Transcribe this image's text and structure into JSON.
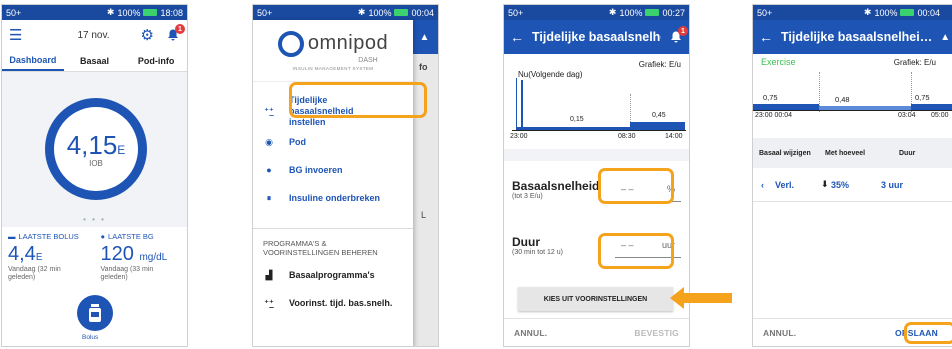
{
  "colors": {
    "brand": "#1e55b5",
    "highlight": "#f5a21c",
    "battery": "#3bd16f",
    "badge": "#e23b3b"
  },
  "status": {
    "signal": "50+",
    "battery": "100%",
    "time1": "18:08",
    "time2": "00:04",
    "time3": "00:27",
    "time4": "00:04"
  },
  "screen1": {
    "date": "17 nov.",
    "badge_count": "1",
    "tabs": [
      "Dashboard",
      "Basaal",
      "Pod-info"
    ],
    "iob_value": "4,15",
    "iob_unit": "E",
    "iob_label": "IOB",
    "dots": "• • •",
    "last_bolus_label": "LAATSTE BOLUS",
    "last_bolus_value": "4,4",
    "last_bolus_unit": "E",
    "last_bolus_sub": "Vandaag (32 min geleden)",
    "last_bg_label": "LAATSTE BG",
    "last_bg_value": "120",
    "last_bg_unit": "mg/dL",
    "last_bg_sub": "Vandaag (33 min geleden)",
    "bolus_label": "Bolus"
  },
  "screen2": {
    "logo_word": "omnipod",
    "logo_dash": "DASH",
    "logo_tagline": "INSULIN MANAGEMENT SYSTEM",
    "behind_text": "fo",
    "behind_text2": "L",
    "menu": [
      "Tijdelijke basaalsnelheid instellen",
      "Pod",
      "BG invoeren",
      "Insuline onderbreken"
    ],
    "section_title": "PROGRAMMA'S & VOORINSTELLINGEN BEHEREN",
    "programs": [
      "Basaalprogramma's",
      "Voorinst. tijd. bas.snelh."
    ]
  },
  "screen3": {
    "title": "Tijdelijke basaalsnelhei…",
    "graph_label": "Grafiek: E/u",
    "now_label": "Nu(Volgende dag)",
    "v1": "0,15",
    "v2": "0,45",
    "t1": "23:00",
    "t2": "08:30",
    "t3": "14:00",
    "rate_title": "Basaalsnelheid",
    "rate_sub": "(tot 3 E/u)",
    "rate_placeholder": "– –",
    "rate_unit": "%",
    "dur_title": "Duur",
    "dur_sub": "(30 min tot 12 u)",
    "dur_placeholder": "– –",
    "dur_unit": "uur",
    "choose_label": "KIES UIT VOORINSTELLINGEN",
    "cancel": "ANNUL.",
    "confirm": "BEVESTIG"
  },
  "screen4": {
    "title": "Tijdelijke basaalsnelhei…",
    "preset": "Exercise",
    "graph_label": "Grafiek: E/u",
    "v1": "0,75",
    "v2": "0,48",
    "v3": "0,75",
    "t1": "23:00 00:04",
    "t2": "03:04",
    "t3": "05:00",
    "col1": "Basaal wijzigen",
    "col2": "Met hoeveel",
    "col3": "Duur",
    "row_dir": "Verl.",
    "row_amount": "35%",
    "row_dur": "3 uur",
    "cancel": "ANNUL.",
    "save": "OPSLAAN"
  }
}
